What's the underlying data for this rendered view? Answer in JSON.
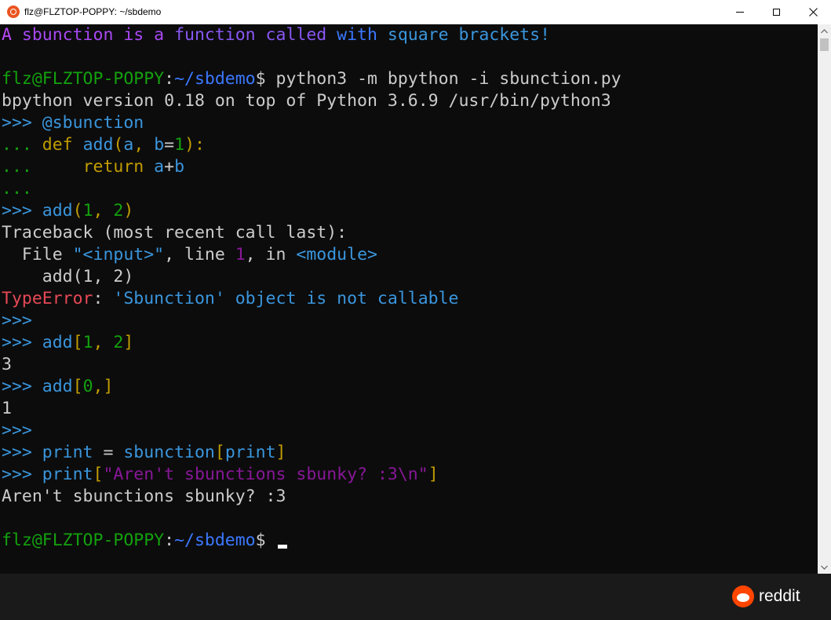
{
  "window": {
    "title": "flz@FLZTOP-POPPY: ~/sbdemo",
    "icon": "ubuntu-icon"
  },
  "colors": {
    "fg": "#cccccc",
    "prompt_green": "#13a10e",
    "path_blue": "#3b78ff",
    "keyword_yellow": "#c19c00",
    "name_blue": "#3a96dd",
    "string_purple": "#881798",
    "error_red": "#e74856",
    "bright_blue": "#3b78ff"
  },
  "terminal": {
    "lines": [
      {
        "segments": [
          {
            "t": "A ",
            "c": "#b648f2"
          },
          {
            "t": "sbunction is a ",
            "c": "#a848f2"
          },
          {
            "t": "function called ",
            "c": "#8857f2"
          },
          {
            "t": "with ",
            "c": "#3b78ff"
          },
          {
            "t": "square brackets!",
            "c": "#3a96dd"
          }
        ]
      },
      {
        "segments": []
      },
      {
        "segments": [
          {
            "t": "flz@FLZTOP-POPPY",
            "c": "#13a10e"
          },
          {
            "t": ":",
            "c": "#cccccc"
          },
          {
            "t": "~/sbdemo",
            "c": "#3b78ff"
          },
          {
            "t": "$ python3 -m bpython -i sbunction.py",
            "c": "#cccccc"
          }
        ]
      },
      {
        "segments": [
          {
            "t": "bpython version 0.18 on top of Python 3.6.9 /usr/bin/python3",
            "c": "#cccccc"
          }
        ]
      },
      {
        "segments": [
          {
            "t": ">>> ",
            "c": "#3a96dd"
          },
          {
            "t": "@sbunction",
            "c": "#3a96dd"
          }
        ]
      },
      {
        "segments": [
          {
            "t": "... ",
            "c": "#13a10e"
          },
          {
            "t": "def ",
            "c": "#c19c00"
          },
          {
            "t": "add",
            "c": "#3a96dd"
          },
          {
            "t": "(",
            "c": "#c19c00"
          },
          {
            "t": "a",
            "c": "#3a96dd"
          },
          {
            "t": ", ",
            "c": "#c19c00"
          },
          {
            "t": "b",
            "c": "#3a96dd"
          },
          {
            "t": "=",
            "c": "#cccccc"
          },
          {
            "t": "1",
            "c": "#13a10e"
          },
          {
            "t": "):",
            "c": "#c19c00"
          }
        ]
      },
      {
        "segments": [
          {
            "t": "...     ",
            "c": "#13a10e"
          },
          {
            "t": "return ",
            "c": "#c19c00"
          },
          {
            "t": "a",
            "c": "#3a96dd"
          },
          {
            "t": "+",
            "c": "#cccccc"
          },
          {
            "t": "b",
            "c": "#3a96dd"
          }
        ]
      },
      {
        "segments": [
          {
            "t": "...",
            "c": "#13a10e"
          }
        ]
      },
      {
        "segments": [
          {
            "t": ">>> ",
            "c": "#3a96dd"
          },
          {
            "t": "add",
            "c": "#3a96dd"
          },
          {
            "t": "(",
            "c": "#c19c00"
          },
          {
            "t": "1",
            "c": "#13a10e"
          },
          {
            "t": ", ",
            "c": "#c19c00"
          },
          {
            "t": "2",
            "c": "#13a10e"
          },
          {
            "t": ")",
            "c": "#c19c00"
          }
        ]
      },
      {
        "segments": [
          {
            "t": "Traceback (most recent call last):",
            "c": "#cccccc"
          }
        ]
      },
      {
        "segments": [
          {
            "t": "  File ",
            "c": "#cccccc"
          },
          {
            "t": "\"<input>\"",
            "c": "#3a96dd"
          },
          {
            "t": ", line ",
            "c": "#cccccc"
          },
          {
            "t": "1",
            "c": "#881798"
          },
          {
            "t": ", in ",
            "c": "#cccccc"
          },
          {
            "t": "<module>",
            "c": "#3a96dd"
          }
        ]
      },
      {
        "segments": [
          {
            "t": "    add(1, 2)",
            "c": "#cccccc"
          }
        ]
      },
      {
        "segments": [
          {
            "t": "TypeError",
            "c": "#e74856"
          },
          {
            "t": ": ",
            "c": "#cccccc"
          },
          {
            "t": "'Sbunction' object is not callable",
            "c": "#3a96dd"
          }
        ]
      },
      {
        "segments": [
          {
            "t": ">>>",
            "c": "#3a96dd"
          }
        ]
      },
      {
        "segments": [
          {
            "t": ">>> ",
            "c": "#3a96dd"
          },
          {
            "t": "add",
            "c": "#3a96dd"
          },
          {
            "t": "[",
            "c": "#c19c00"
          },
          {
            "t": "1",
            "c": "#13a10e"
          },
          {
            "t": ", ",
            "c": "#c19c00"
          },
          {
            "t": "2",
            "c": "#13a10e"
          },
          {
            "t": "]",
            "c": "#c19c00"
          }
        ]
      },
      {
        "segments": [
          {
            "t": "3",
            "c": "#cccccc"
          }
        ]
      },
      {
        "segments": [
          {
            "t": ">>> ",
            "c": "#3a96dd"
          },
          {
            "t": "add",
            "c": "#3a96dd"
          },
          {
            "t": "[",
            "c": "#c19c00"
          },
          {
            "t": "0",
            "c": "#13a10e"
          },
          {
            "t": ",]",
            "c": "#c19c00"
          }
        ]
      },
      {
        "segments": [
          {
            "t": "1",
            "c": "#cccccc"
          }
        ]
      },
      {
        "segments": [
          {
            "t": ">>>",
            "c": "#3a96dd"
          }
        ]
      },
      {
        "segments": [
          {
            "t": ">>> ",
            "c": "#3a96dd"
          },
          {
            "t": "print",
            "c": "#3a96dd"
          },
          {
            "t": " = ",
            "c": "#cccccc"
          },
          {
            "t": "sbunction",
            "c": "#3a96dd"
          },
          {
            "t": "[",
            "c": "#c19c00"
          },
          {
            "t": "print",
            "c": "#3a96dd"
          },
          {
            "t": "]",
            "c": "#c19c00"
          }
        ]
      },
      {
        "segments": [
          {
            "t": ">>> ",
            "c": "#3a96dd"
          },
          {
            "t": "print",
            "c": "#3a96dd"
          },
          {
            "t": "[",
            "c": "#c19c00"
          },
          {
            "t": "\"Aren't sbunctions sbunky? :3\\n\"",
            "c": "#881798"
          },
          {
            "t": "]",
            "c": "#c19c00"
          }
        ]
      },
      {
        "segments": [
          {
            "t": "Aren't sbunctions sbunky? :3",
            "c": "#cccccc"
          }
        ]
      },
      {
        "segments": []
      },
      {
        "segments": [
          {
            "t": "flz@FLZTOP-POPPY",
            "c": "#13a10e"
          },
          {
            "t": ":",
            "c": "#cccccc"
          },
          {
            "t": "~/sbdemo",
            "c": "#3b78ff"
          },
          {
            "t": "$ ",
            "c": "#cccccc"
          }
        ],
        "cursor": true
      }
    ]
  },
  "footer": {
    "brand": "reddit",
    "logo_icon": "reddit-logo-icon"
  }
}
